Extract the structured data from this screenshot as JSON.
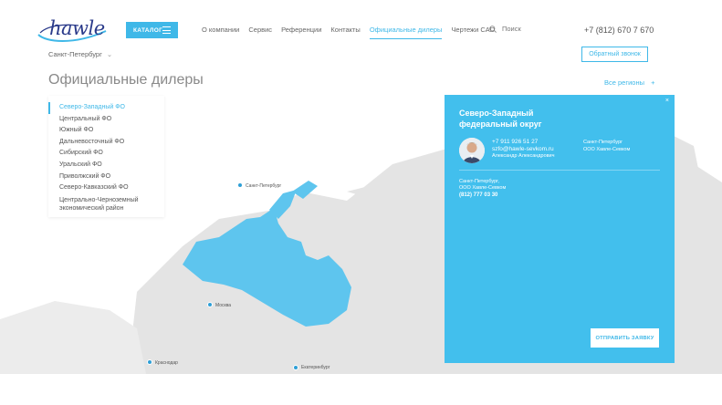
{
  "header": {
    "logo_text": "hawle",
    "catalog_label": "КАТАЛОГ",
    "nav": [
      "О компании",
      "Сервис",
      "Референции",
      "Контакты",
      "Официальные дилеры",
      "Чертежи CAD"
    ],
    "nav_active_index": 4,
    "search_label": "Поиск",
    "phone": "+7 (812) 670 7 670",
    "city": "Санкт-Петербург",
    "callback_label": "Обратный звонок"
  },
  "page": {
    "title": "Официальные дилеры",
    "all_regions_label": "Все регионы",
    "all_regions_icon": "+"
  },
  "districts": [
    "Северо-Западный ФО",
    "Центральный ФО",
    "Южный ФО",
    "Дальневосточный ФО",
    "Сибирский ФО",
    "Уральский ФО",
    "Приволжский ФО",
    "Северо-Кавказский ФО",
    "Центрально-Черноземный экономический район"
  ],
  "districts_active_index": 0,
  "popup": {
    "close_icon": "×",
    "title": "Северо-Западный федеральный округ",
    "contact": {
      "phone": "+7 911 926 51 27",
      "email": "szfo@hawle-sevkom.ru",
      "name": "Александр Александрович",
      "city": "Санкт-Петербург",
      "company": "ООО Хавле-Севком"
    },
    "dealer": {
      "city": "Санкт-Петербург,",
      "company": "ООО Хавле-Севком",
      "phone": "(812) 777 03 30"
    },
    "send_label": "ОТПРАВИТЬ ЗАЯВКУ"
  },
  "map_labels": {
    "spb": "Санкт-Петербург",
    "moscow": "Москва",
    "krasnodar": "Краснодар",
    "ekb": "Екатеринбург"
  },
  "colors": {
    "accent": "#3fb8e8",
    "popup_bg": "#42bfed",
    "region_highlight": "#5ec5ee",
    "map_land": "#e4e4e4"
  }
}
